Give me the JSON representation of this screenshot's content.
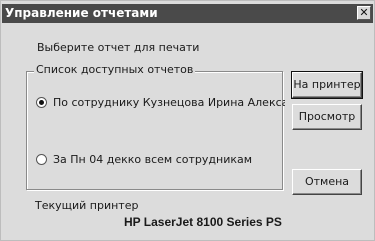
{
  "window": {
    "title": "Управление отчетами",
    "close_glyph": "✕"
  },
  "prompt": "Выберите отчет для печати",
  "report_group": {
    "title": "Список доступных отчетов",
    "options": [
      {
        "label": "По сотруднику Кузнецова Ирина Александ",
        "selected": true
      },
      {
        "label": "За Пн 04 декко всем сотрудникам",
        "selected": false
      }
    ]
  },
  "buttons": {
    "print": "На принтер",
    "preview": "Просмотр",
    "cancel": "Отмена"
  },
  "printer": {
    "label": "Текущий принтер",
    "name": "HP LaserJet 8100 Series PS"
  }
}
